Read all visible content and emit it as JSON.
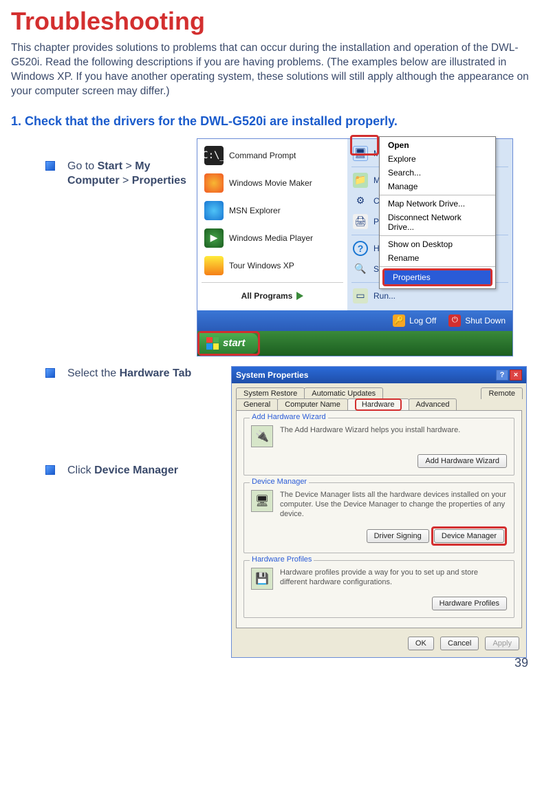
{
  "title": "Troubleshooting",
  "intro": "This chapter provides solutions to problems that can occur during the installation and operation of the DWL-G520i. Read the following descriptions if you are having problems. (The examples below are illustrated in Windows XP. If you have another operating system, these solutions will still apply although the appearance on your computer screen may differ.)",
  "step1_title": "1.  Check that the drivers for the DWL-G520i are installed properly.",
  "instr1": {
    "pre": "Go to ",
    "b1": "Start",
    "mid1": " >  ",
    "b2": "My Computer",
    "mid2": " > ",
    "b3": "Properties"
  },
  "instr2": {
    "pre": "Select the ",
    "b1": "Hardware Tab"
  },
  "instr3": {
    "pre": "Click ",
    "b1": "Device Manager"
  },
  "startmenu": {
    "left": {
      "cmd": "Command Prompt",
      "wmm": "Windows Movie Maker",
      "msn": "MSN Explorer",
      "wmp": "Windows Media Player",
      "tour": "Tour Windows XP",
      "allprograms": "All Programs"
    },
    "right": {
      "mycomp_short": "My",
      "m": "M",
      "co": "Co",
      "pr": "Pr",
      "he": "He",
      "se": "Se",
      "run": "Run..."
    },
    "context": {
      "open": "Open",
      "explore": "Explore",
      "search": "Search...",
      "manage": "Manage",
      "map": "Map Network Drive...",
      "disconnect": "Disconnect Network Drive...",
      "show": "Show on Desktop",
      "rename": "Rename",
      "properties": "Properties"
    },
    "footer": {
      "logoff": "Log Off",
      "shutdown": "Shut Down"
    },
    "startbtn": "start"
  },
  "sysprops": {
    "title": "System Properties",
    "tabs_top": {
      "restore": "System Restore",
      "updates": "Automatic Updates",
      "remote": "Remote"
    },
    "tabs_bot": {
      "general": "General",
      "compname": "Computer Name",
      "hardware": "Hardware",
      "advanced": "Advanced"
    },
    "grp_add": {
      "label": "Add Hardware Wizard",
      "text": "The Add Hardware Wizard helps you install hardware.",
      "btn": "Add Hardware Wizard"
    },
    "grp_dm": {
      "label": "Device Manager",
      "text": "The Device Manager lists all the hardware devices installed on your computer. Use the Device Manager to change the properties of any device.",
      "btn_sign": "Driver Signing",
      "btn_dm": "Device Manager"
    },
    "grp_hp": {
      "label": "Hardware Profiles",
      "text": "Hardware profiles provide a way for you to set up and store different hardware configurations.",
      "btn": "Hardware Profiles"
    },
    "buttons": {
      "ok": "OK",
      "cancel": "Cancel",
      "apply": "Apply"
    }
  },
  "pagenum": "39"
}
